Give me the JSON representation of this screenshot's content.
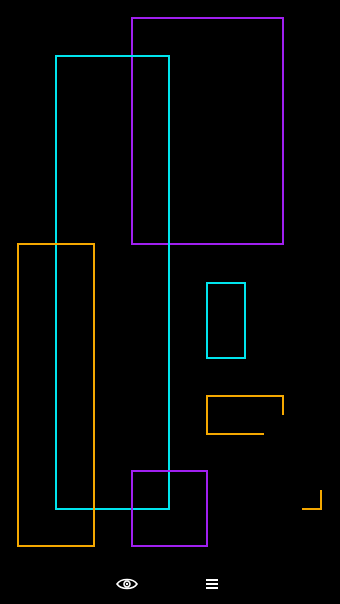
{
  "colors": {
    "background": "#000000",
    "purple": "#A020F0",
    "cyan": "#00E5EE",
    "orange": "#F5A800",
    "icon": "#FFFFFF"
  },
  "board": {
    "shapes": [
      {
        "name": "purple-rect-large",
        "color": "purple",
        "kind": "rect"
      },
      {
        "name": "cyan-rect-tall",
        "color": "cyan",
        "kind": "rect"
      },
      {
        "name": "orange-rect-tall",
        "color": "orange",
        "kind": "rect"
      },
      {
        "name": "cyan-rect-small",
        "color": "cyan",
        "kind": "rect"
      },
      {
        "name": "orange-bracket-open",
        "color": "orange",
        "kind": "bracket"
      },
      {
        "name": "purple-rect-small",
        "color": "purple",
        "kind": "rect"
      },
      {
        "name": "orange-corner-piece",
        "color": "orange",
        "kind": "corner"
      }
    ]
  },
  "toolbar": {
    "visibility_icon": "eye-icon",
    "menu_icon": "menu-icon"
  }
}
